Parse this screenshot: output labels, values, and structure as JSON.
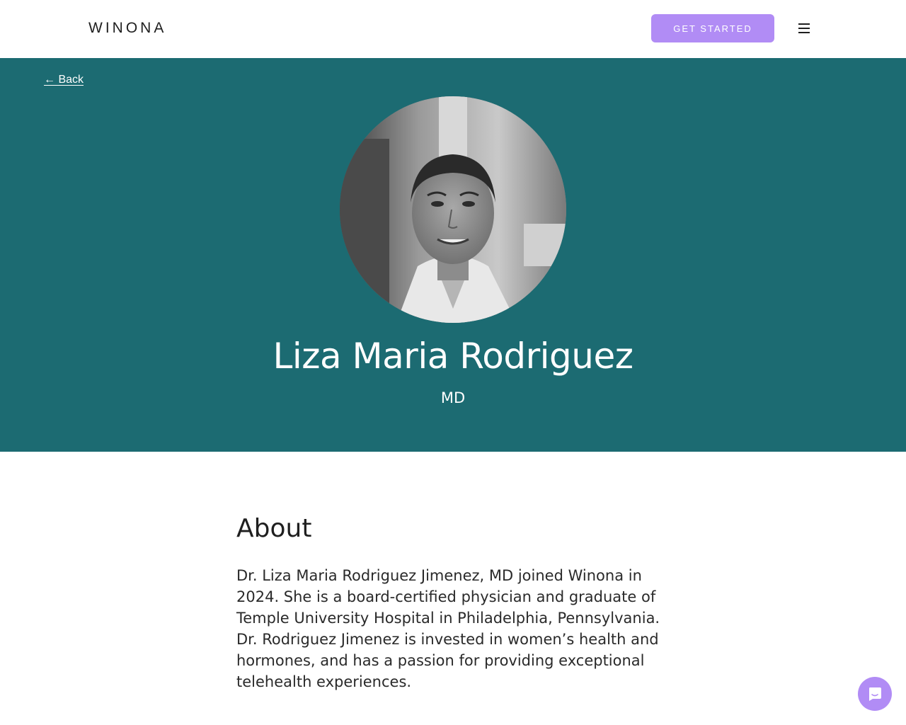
{
  "header": {
    "logo": "WINONA",
    "cta_label": "GET STARTED",
    "menu_icon": "hamburger-menu-icon"
  },
  "hero": {
    "back_label": "← Back",
    "name": "Liza Maria Rodriguez",
    "credential": "MD",
    "background_color": "#1c6b72"
  },
  "about": {
    "heading": "About",
    "body": "Dr. Liza Maria Rodriguez Jimenez, MD joined Winona in 2024. She is a board-certified physician and graduate of Temple University Hospital in Philadelphia, Pennsylvania. Dr. Rodriguez Jimenez is invested in women’s health and hormones, and has a passion for providing exceptional telehealth experiences."
  },
  "chat": {
    "icon": "chat-bubble-icon"
  },
  "colors": {
    "accent": "#b18cf5",
    "hero": "#1c6b72"
  }
}
